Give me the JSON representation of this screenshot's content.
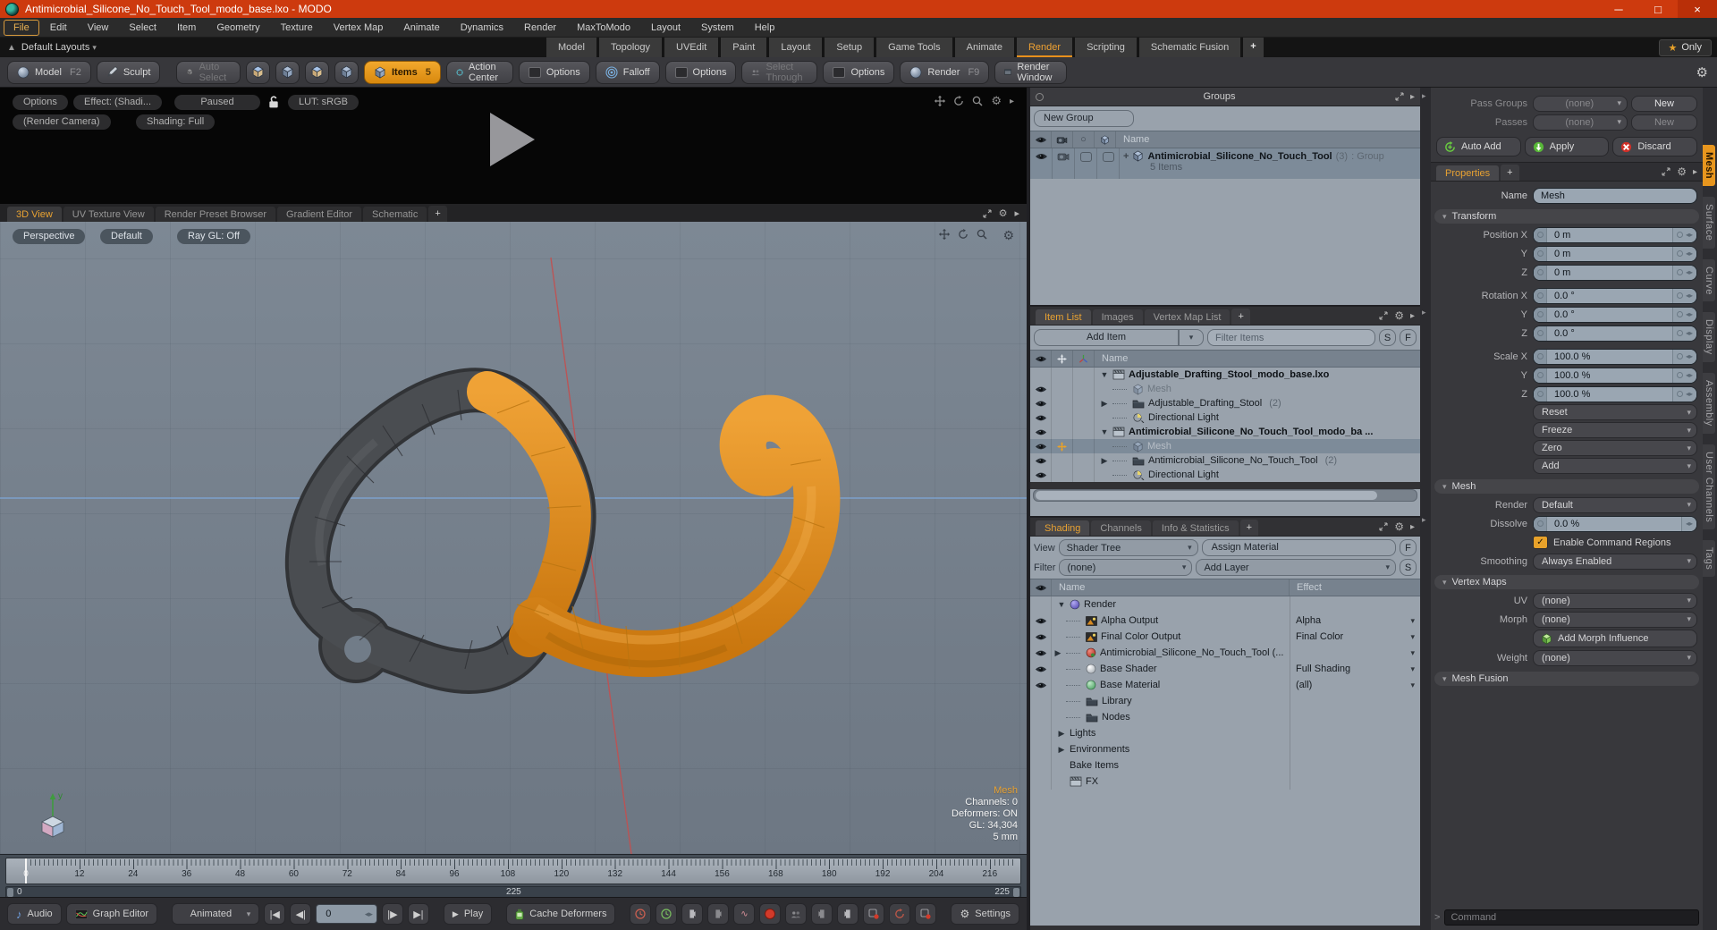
{
  "window": {
    "title": "Antimicrobial_Silicone_No_Touch_Tool_modo_base.lxo - MODO"
  },
  "menu": {
    "items": [
      "File",
      "Edit",
      "View",
      "Select",
      "Item",
      "Geometry",
      "Texture",
      "Vertex Map",
      "Animate",
      "Dynamics",
      "Render",
      "MaxToModo",
      "Layout",
      "System",
      "Help"
    ],
    "active": "File"
  },
  "layout_bar": {
    "layouts_label": "Default Layouts",
    "tabs": [
      "Model",
      "Topology",
      "UVEdit",
      "Paint",
      "Layout",
      "Setup",
      "Game Tools",
      "Animate",
      "Render",
      "Scripting",
      "Schematic Fusion"
    ],
    "active_tab": "Render",
    "add_tab": "+",
    "only_label": "Only"
  },
  "toolbar": {
    "model": "Model",
    "model_key": "F2",
    "sculpt": "Sculpt",
    "auto_select": "Auto Select",
    "items": "Items",
    "items_badge": "5",
    "action_center": "Action Center",
    "options": "Options",
    "falloff": "Falloff",
    "select_through": "Select Through",
    "render": "Render",
    "render_key": "F9",
    "render_window": "Render Window"
  },
  "render_strip": {
    "options": "Options",
    "effect": "Effect: (Shadi...",
    "paused": "Paused",
    "lut": "LUT: sRGB",
    "render_camera": "(Render Camera)",
    "shading": "Shading: Full"
  },
  "viewport": {
    "tabs": [
      "3D View",
      "UV Texture View",
      "Render Preset Browser",
      "Gradient Editor",
      "Schematic"
    ],
    "active_tab": "3D View",
    "add_tab": "+",
    "controls": [
      "Perspective",
      "Default",
      "Ray GL: Off"
    ],
    "info": {
      "title": "Mesh",
      "lines": [
        "Channels: 0",
        "Deformers: ON",
        "GL: 34,304",
        "5 mm"
      ]
    },
    "gizmo_axis": "y"
  },
  "timeline": {
    "ticks": [
      0,
      12,
      24,
      36,
      48,
      60,
      72,
      84,
      96,
      108,
      120,
      132,
      144,
      156,
      168,
      180,
      192,
      204,
      216
    ],
    "range_start": "0",
    "range_mid": "225",
    "range_end": "225"
  },
  "transport": {
    "audio": "Audio",
    "graph_editor": "Graph Editor",
    "mode": "Animated",
    "frame": "0",
    "play": "Play",
    "cache_deformers": "Cache Deformers",
    "settings": "Settings"
  },
  "groups_panel": {
    "title": "Groups",
    "new_group": "New Group",
    "name_col": "Name",
    "row": {
      "name": "Antimicrobial_Silicone_No_Touch_Tool",
      "count": "(3)",
      "suffix": ": Group",
      "sub": "5 Items"
    }
  },
  "item_list": {
    "tabs": [
      "Item List",
      "Images",
      "Vertex Map List"
    ],
    "active_tab": "Item List",
    "add_tab": "+",
    "add_item": "Add Item",
    "filter_placeholder": "Filter Items",
    "s": "S",
    "f": "F",
    "name_col": "Name",
    "rows": [
      {
        "label": "Adjustable_Drafting_Stool_modo_base.lxo",
        "icon": "scene",
        "bold": true,
        "expander": "down",
        "eye": false,
        "indent": 0
      },
      {
        "label": "Mesh",
        "icon": "mesh",
        "dim": true,
        "eye": true,
        "indent": 2
      },
      {
        "label": "Adjustable_Drafting_Stool",
        "suffix": "(2)",
        "icon": "group",
        "eye": true,
        "expander": "right",
        "indent": 2
      },
      {
        "label": "Directional Light",
        "icon": "light",
        "eye": true,
        "indent": 2
      },
      {
        "label": "Antimicrobial_Silicone_No_Touch_Tool_modo_ba ...",
        "icon": "scene",
        "bold": true,
        "expander": "down",
        "eye": true,
        "indent": 0
      },
      {
        "label": "Mesh",
        "icon": "mesh",
        "dim": true,
        "eye": true,
        "selected": true,
        "cross": true,
        "indent": 2
      },
      {
        "label": "Antimicrobial_Silicone_No_Touch_Tool",
        "suffix": "(2)",
        "icon": "group",
        "eye": true,
        "expander": "right",
        "indent": 2
      },
      {
        "label": "Directional Light",
        "icon": "light",
        "eye": true,
        "indent": 2
      }
    ]
  },
  "shading": {
    "tabs": [
      "Shading",
      "Channels",
      "Info & Statistics"
    ],
    "active_tab": "Shading",
    "add_tab": "+",
    "view_label": "View",
    "view_value": "Shader Tree",
    "assign_material": "Assign Material",
    "f": "F",
    "filter_label": "Filter",
    "filter_value": "(none)",
    "add_layer": "Add Layer",
    "s": "S",
    "name_col": "Name",
    "effect_col": "Effect",
    "rows": [
      {
        "label": "Render",
        "icon": "render",
        "expander": "down",
        "indent": 1
      },
      {
        "label": "Alpha Output",
        "icon": "output",
        "effect": "Alpha",
        "eye": true,
        "indent": 2,
        "dropdown": true
      },
      {
        "label": "Final Color Output",
        "icon": "output",
        "effect": "Final Color",
        "eye": true,
        "indent": 2,
        "dropdown": true
      },
      {
        "label": "Antimicrobial_Silicone_No_Touch_Tool (...",
        "icon": "matred",
        "eye": true,
        "expander": "right",
        "indent": 2,
        "dropdown": true
      },
      {
        "label": "Base Shader",
        "icon": "shaderball",
        "effect": "Full Shading",
        "eye": true,
        "indent": 2,
        "dropdown": true
      },
      {
        "label": "Base Material",
        "icon": "matgreen",
        "effect": "(all)",
        "eye": true,
        "indent": 2,
        "dropdown": true
      },
      {
        "label": "Library",
        "icon": "group",
        "indent": 2
      },
      {
        "label": "Nodes",
        "icon": "group",
        "indent": 2
      },
      {
        "label": "Lights",
        "expander": "right",
        "indent": 1
      },
      {
        "label": "Environments",
        "expander": "right",
        "indent": 1
      },
      {
        "label": "Bake Items",
        "indent": 1
      },
      {
        "label": "FX",
        "icon": "scene",
        "indent": 1
      }
    ]
  },
  "properties": {
    "pass_groups_label": "Pass Groups",
    "passes_label": "Passes",
    "none_value": "(none)",
    "new_label": "New",
    "auto_add": "Auto Add",
    "apply": "Apply",
    "discard": "Discard",
    "tab": "Properties",
    "add_tab": "+",
    "name_label": "Name",
    "name_value": "Mesh",
    "sections": {
      "transform": "Transform",
      "mesh": "Mesh",
      "vertex_maps": "Vertex Maps",
      "mesh_fusion": "Mesh Fusion"
    },
    "transform_rows": [
      {
        "label": "Position X",
        "value": "0 m"
      },
      {
        "label": "Y",
        "value": "0 m"
      },
      {
        "label": "Z",
        "value": "0 m"
      },
      {
        "label": "Rotation X",
        "value": "0.0 °",
        "gap": true
      },
      {
        "label": "Y",
        "value": "0.0 °"
      },
      {
        "label": "Z",
        "value": "0.0 °"
      },
      {
        "label": "Scale X",
        "value": "100.0 %",
        "gap": true
      },
      {
        "label": "Y",
        "value": "100.0 %"
      },
      {
        "label": "Z",
        "value": "100.0 %"
      }
    ],
    "transform_buttons": [
      "Reset",
      "Freeze",
      "Zero",
      "Add"
    ],
    "mesh_rows": {
      "render_label": "Render",
      "render_value": "Default",
      "dissolve_label": "Dissolve",
      "dissolve_value": "0.0 %",
      "checkbox_label": "Enable Command Regions",
      "smoothing_label": "Smoothing",
      "smoothing_value": "Always Enabled"
    },
    "vertex_rows": {
      "uv_label": "UV",
      "uv_value": "(none)",
      "morph_label": "Morph",
      "morph_value": "(none)",
      "add_morph": "Add Morph Influence",
      "weight_label": "Weight",
      "weight_value": "(none)"
    },
    "command_placeholder": "Command"
  },
  "side_tabs": {
    "items": [
      "Mesh",
      "Surface",
      "Curve",
      "Display",
      "Assembly",
      "User Channels",
      "Tags"
    ],
    "active": "Mesh"
  },
  "colors": {
    "titlebar": "#cd3a0e",
    "accent": "#e8a232",
    "tabactive": "#f0a232",
    "viewport_bg": "#77828f",
    "panel_light": "#99a2ac",
    "model_orange": "#e0861c",
    "model_gray": "#46484b",
    "axis_blue": "#7fa7d8",
    "axis_red": "#c25050",
    "axis_green": "#3f9b3f"
  }
}
